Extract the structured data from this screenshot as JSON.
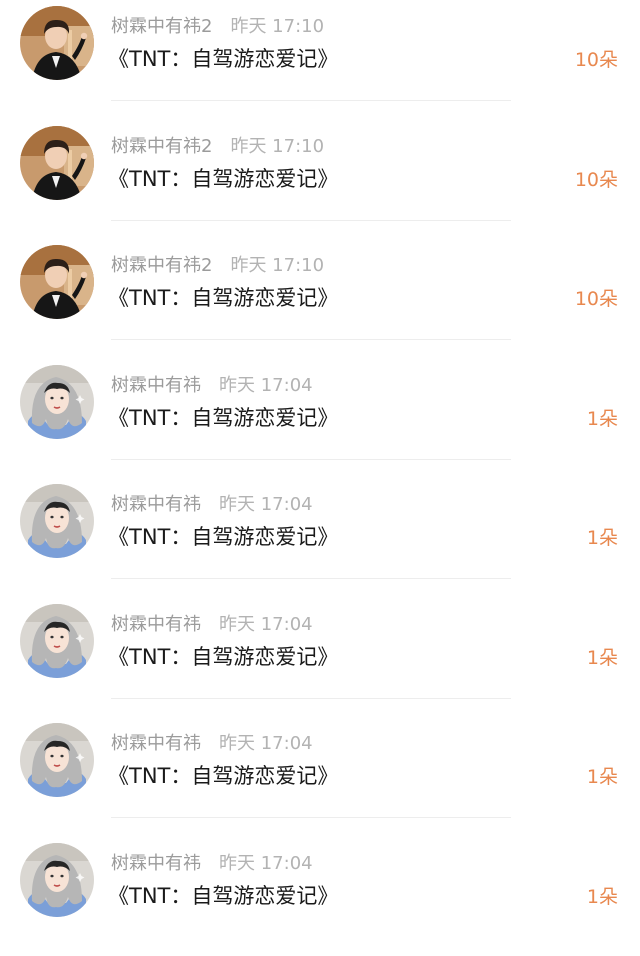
{
  "items": [
    {
      "name": "树霖中有祎2",
      "time": "昨天 17:10",
      "title": "《TNT：自驾游恋爱记》",
      "gift": "10朵",
      "avatar": "avatar-a"
    },
    {
      "name": "树霖中有祎2",
      "time": "昨天 17:10",
      "title": "《TNT：自驾游恋爱记》",
      "gift": "10朵",
      "avatar": "avatar-a"
    },
    {
      "name": "树霖中有祎2",
      "time": "昨天 17:10",
      "title": "《TNT：自驾游恋爱记》",
      "gift": "10朵",
      "avatar": "avatar-a"
    },
    {
      "name": "树霖中有祎",
      "time": "昨天 17:04",
      "title": "《TNT：自驾游恋爱记》",
      "gift": "1朵",
      "avatar": "avatar-b"
    },
    {
      "name": "树霖中有祎",
      "time": "昨天 17:04",
      "title": "《TNT：自驾游恋爱记》",
      "gift": "1朵",
      "avatar": "avatar-b"
    },
    {
      "name": "树霖中有祎",
      "time": "昨天 17:04",
      "title": "《TNT：自驾游恋爱记》",
      "gift": "1朵",
      "avatar": "avatar-b"
    },
    {
      "name": "树霖中有祎",
      "time": "昨天 17:04",
      "title": "《TNT：自驾游恋爱记》",
      "gift": "1朵",
      "avatar": "avatar-b"
    },
    {
      "name": "树霖中有祎",
      "time": "昨天 17:04",
      "title": "《TNT：自驾游恋爱记》",
      "gift": "1朵",
      "avatar": "avatar-b"
    }
  ],
  "colors": {
    "gift": "#e8884f",
    "name": "#9b9b9b",
    "title": "#1a1a1a",
    "divider": "#ededed"
  }
}
